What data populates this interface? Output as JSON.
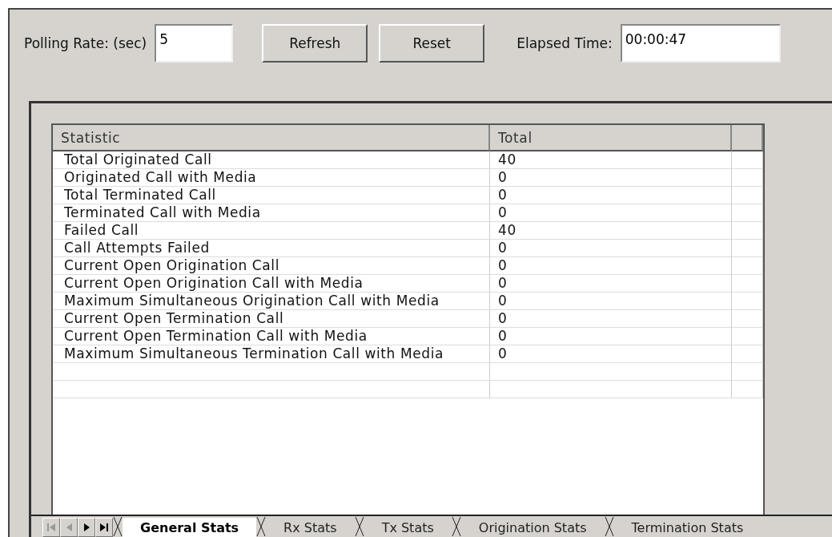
{
  "toolbar": {
    "polling_label": "Polling Rate: (sec)",
    "polling_value": "5",
    "buttons": [
      "Refresh",
      "Reset"
    ],
    "elapsed_label": "Elapsed Time:",
    "elapsed_value": "00:00:47"
  },
  "table": {
    "columns": [
      "Statistic",
      "Total"
    ],
    "rows": [
      {
        "statistic": "Total Originated Call",
        "total": "40"
      },
      {
        "statistic": "Originated Call with Media",
        "total": "0"
      },
      {
        "statistic": "Total Terminated Call",
        "total": "0"
      },
      {
        "statistic": "Terminated Call with Media",
        "total": "0"
      },
      {
        "statistic": "Failed Call",
        "total": "40"
      },
      {
        "statistic": "Call Attempts Failed",
        "total": "0"
      },
      {
        "statistic": "Current Open Origination Call",
        "total": "0"
      },
      {
        "statistic": "Current Open Origination Call with Media",
        "total": "0"
      },
      {
        "statistic": "Maximum Simultaneous Origination Call with Media",
        "total": "0"
      },
      {
        "statistic": "Current Open Termination Call",
        "total": "0"
      },
      {
        "statistic": "Current Open Termination Call with Media",
        "total": "0"
      },
      {
        "statistic": "Maximum Simultaneous Termination Call with Media",
        "total": "0"
      }
    ]
  },
  "sheet_tabs": [
    {
      "label": "General Stats",
      "selected": true
    },
    {
      "label": "Rx Stats",
      "selected": false
    },
    {
      "label": "Tx Stats",
      "selected": false
    },
    {
      "label": "Origination Stats",
      "selected": false
    },
    {
      "label": "Termination Stats",
      "selected": false
    }
  ]
}
